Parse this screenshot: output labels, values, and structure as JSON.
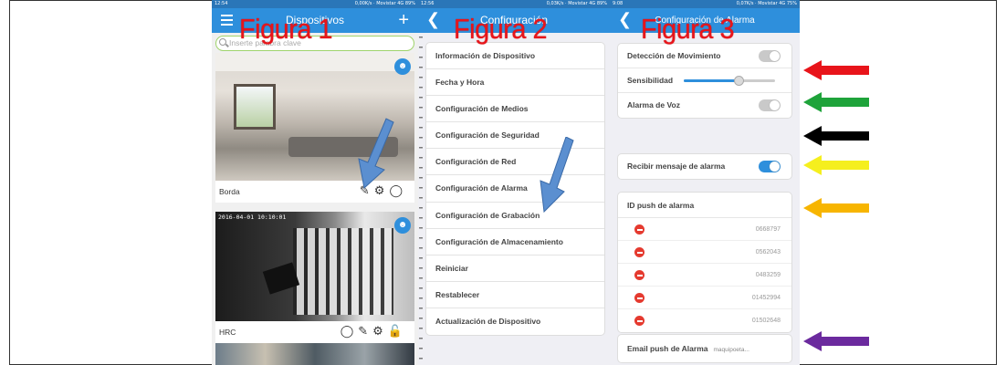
{
  "figures": {
    "fig1": "Figura 1",
    "fig2": "Figura 2",
    "fig3": "Figura 3"
  },
  "colors": {
    "appbar": "#2e8fdc",
    "label_red": "#e8141a",
    "arrow_red": "#e8141a",
    "arrow_green": "#1ea33a",
    "arrow_black": "#000000",
    "arrow_yellow": "#f5ef1e",
    "arrow_orange": "#f7b500",
    "arrow_purple": "#6b2a9e",
    "arrow_blue": "#5b8fd0"
  },
  "phone1": {
    "status_left": "12:54",
    "status_right": "0,00K/s · Movistar 4G 89%",
    "appbar_title": "Dispositivos",
    "search_placeholder": "Inserte palabra clave",
    "cameras": [
      {
        "name": "Borda"
      },
      {
        "name": "HRC",
        "timestamp": "2016-04-01 10:10:01"
      }
    ],
    "icons": [
      "edit-icon",
      "gear-icon",
      "alarm-icon",
      "lock-icon"
    ]
  },
  "phone2": {
    "status_left": "12:56",
    "status_right": "0,03K/s · Movistar 4G 89%",
    "appbar_title": "Configuración",
    "items": [
      "Información de Dispositivo",
      "Fecha y Hora",
      "Configuración de Medios",
      "Configuración de Seguridad",
      "Configuración de Red",
      "Configuración de Alarma",
      "Configuración de Grabación",
      "Configuración de Almacenamiento",
      "Reiniciar",
      "Restablecer",
      "Actualización de Dispositivo"
    ]
  },
  "phone3": {
    "status_left": "9:08",
    "status_right": "0,07K/s · Movistar 4G 75%",
    "appbar_title": "Configuración de Alarma",
    "motion_label": "Detección de Movimiento",
    "motion_on": false,
    "sensitivity_label": "Sensibilidad",
    "sensitivity_level": 0.6,
    "voice_label": "Alarma de Voz",
    "voice_on": false,
    "receive_label": "Recibir mensaje de alarma",
    "receive_on": true,
    "push_id_label": "ID push de alarma",
    "push_ids": [
      "0668797",
      "0562043",
      "0483259",
      "01452994",
      "01502648"
    ],
    "email_label": "Email push de Alarma",
    "email_value": "maquipoeta..."
  }
}
